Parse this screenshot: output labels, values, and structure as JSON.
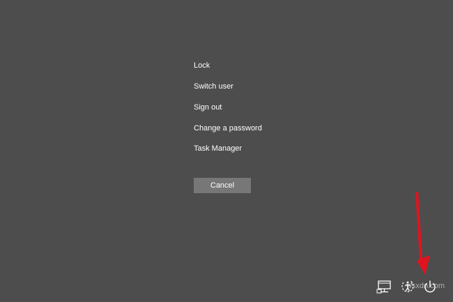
{
  "menu": {
    "items": [
      {
        "label": "Lock"
      },
      {
        "label": "Switch user"
      },
      {
        "label": "Sign out"
      },
      {
        "label": "Change a password"
      },
      {
        "label": "Task Manager"
      }
    ]
  },
  "cancel_label": "Cancel",
  "tray": {
    "icons": [
      "network-icon",
      "ease-of-access-icon",
      "power-icon"
    ]
  },
  "watermark": "wsxdn.com",
  "colors": {
    "background": "#4d4d4d",
    "text": "#ffffff",
    "button": "#777777",
    "annotation_arrow": "#e0141e"
  }
}
